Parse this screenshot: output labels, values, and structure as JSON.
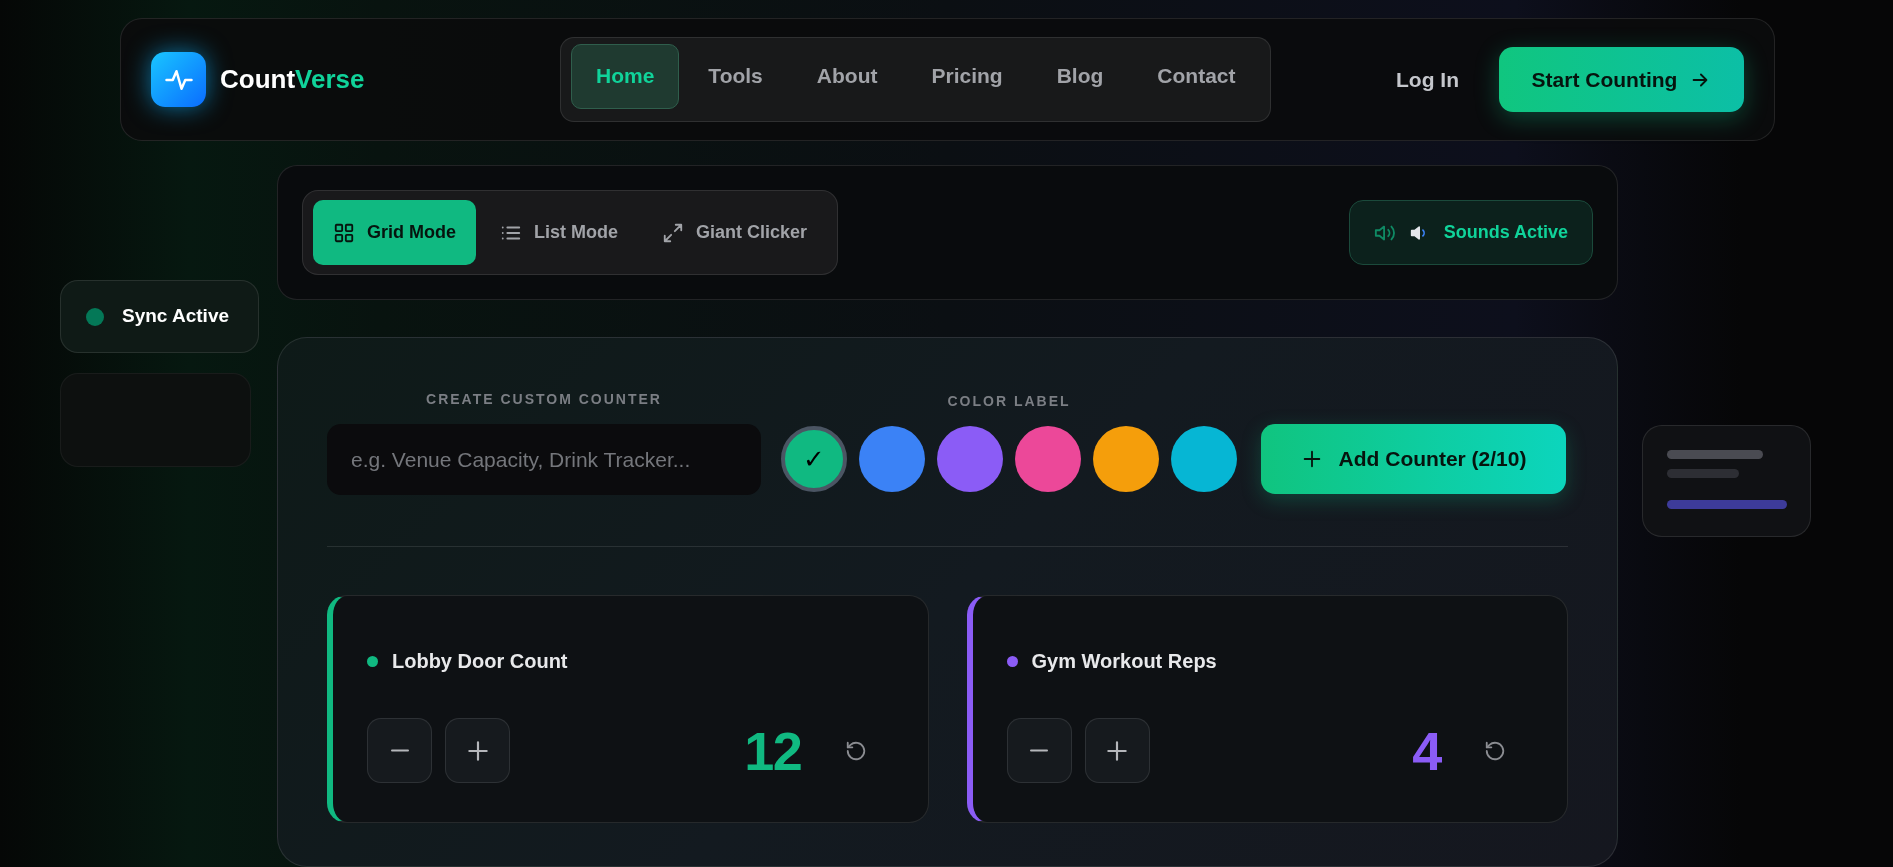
{
  "brand": {
    "name": "Count",
    "accent": "Verse"
  },
  "nav": {
    "items": [
      {
        "label": "Home",
        "selected": true
      },
      {
        "label": "Tools",
        "selected": false
      },
      {
        "label": "About",
        "selected": false
      },
      {
        "label": "Pricing",
        "selected": false
      },
      {
        "label": "Blog",
        "selected": false
      },
      {
        "label": "Contact",
        "selected": false
      }
    ],
    "login": "Log In",
    "cta": "Start Counting"
  },
  "modes": [
    {
      "label": "Grid Mode",
      "kind": "grid",
      "selected": true
    },
    {
      "label": "List Mode",
      "kind": "list",
      "selected": false
    },
    {
      "label": "Giant Clicker",
      "kind": "expand",
      "selected": false
    }
  ],
  "sounds": {
    "label": "Sounds Active",
    "on": true
  },
  "sync": {
    "label": "Sync Active"
  },
  "creator": {
    "name_label": "CREATE CUSTOM COUNTER",
    "placeholder": "e.g. Venue Capacity, Drink Tracker...",
    "color_label": "COLOR LABEL",
    "colors": [
      {
        "color": "#10b981",
        "selected": true
      },
      {
        "color": "#3b82f6",
        "selected": false
      },
      {
        "color": "#8b5cf6",
        "selected": false
      },
      {
        "color": "#ec4899",
        "selected": false
      },
      {
        "color": "#f59e0b",
        "selected": false
      },
      {
        "color": "#06b6d4",
        "selected": false
      }
    ],
    "check": "✓",
    "add_button": "Add Counter (2/10)"
  },
  "counters": [
    {
      "name": "Lobby Door Count",
      "value": "12",
      "color": "#10b981"
    },
    {
      "name": "Gym Workout Reps",
      "value": "4",
      "color": "#8b5cf6"
    }
  ]
}
